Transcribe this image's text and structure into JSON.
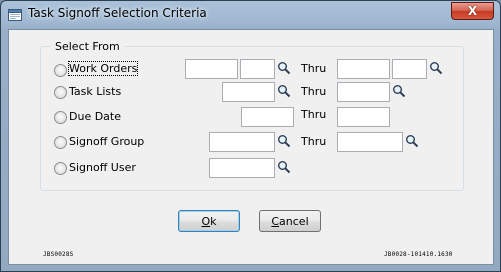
{
  "window": {
    "title": "Task Signoff Selection Criteria",
    "close_label": "X"
  },
  "group": {
    "label": "Select From"
  },
  "rows": [
    {
      "label": "Work Orders",
      "thru_label": "Thru",
      "from_value": "",
      "from_value2": "",
      "to_value": "",
      "to_value2": ""
    },
    {
      "label": "Task Lists",
      "thru_label": "Thru",
      "from_value": "",
      "to_value": ""
    },
    {
      "label": "Due Date",
      "thru_label": "Thru",
      "from_value": "",
      "to_value": ""
    },
    {
      "label": "Signoff Group",
      "thru_label": "Thru",
      "from_value": "",
      "to_value": ""
    },
    {
      "label": "Signoff User",
      "from_value": ""
    }
  ],
  "buttons": {
    "ok_mnemonic": "O",
    "ok_rest": "k",
    "cancel_mnemonic": "C",
    "cancel_rest": "ancel"
  },
  "footer": {
    "left_id": "JBS0028S",
    "right_id": "JB0028-101410.1630"
  },
  "icons": {
    "app": "app-form-icon",
    "lookup": "magnifier-icon"
  }
}
